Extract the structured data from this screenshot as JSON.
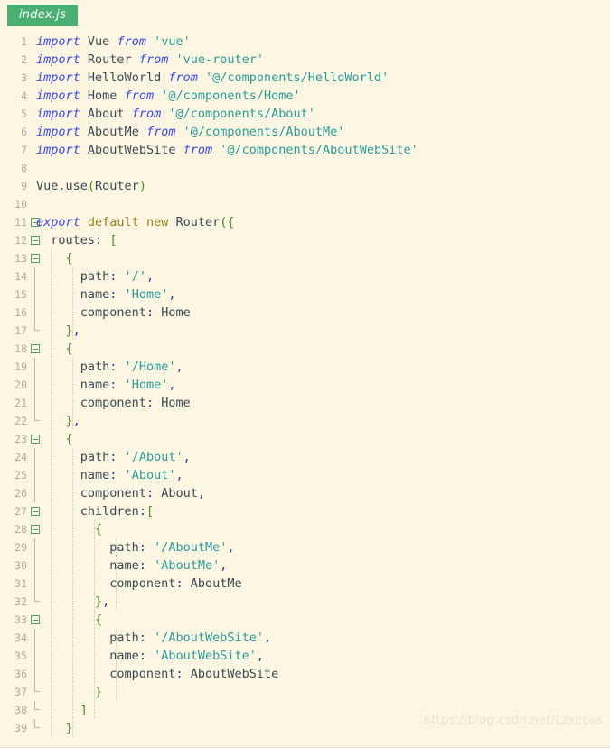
{
  "window": {
    "background_color": "#fdf6e3",
    "title": "index.js"
  },
  "tab": {
    "label": "index.js",
    "active": true,
    "background_color": "#4caf72",
    "text_color": "#ffffff"
  },
  "watermark": {
    "text": "https://blog.csdn.net/Lzxccas",
    "color": "#ece3cb"
  },
  "editor": {
    "language": "javascript",
    "first_line": 1,
    "last_line": 39,
    "line_count": 39,
    "theme_colors": {
      "background": "#fdf6e3",
      "keyword": "#3b4ae0",
      "keyword_secondary": "#93801f",
      "identifier": "#3b4a52",
      "string": "#2e9b97",
      "punctuation": "#4d8c2e",
      "colon": "#2a3f8f",
      "line_number": "#b3ab93",
      "fold_marker": "#5aa06e",
      "indent_guide": "#cfc8ae"
    },
    "lines": [
      {
        "n": 1,
        "fold": "none",
        "guides": 0,
        "tokens": [
          {
            "t": "import",
            "c": "kw"
          },
          {
            "t": " ",
            "c": "id"
          },
          {
            "t": "Vue",
            "c": "id"
          },
          {
            "t": " ",
            "c": "id"
          },
          {
            "t": "from",
            "c": "kw"
          },
          {
            "t": " ",
            "c": "id"
          },
          {
            "t": "'vue'",
            "c": "str"
          }
        ]
      },
      {
        "n": 2,
        "fold": "none",
        "guides": 0,
        "tokens": [
          {
            "t": "import",
            "c": "kw"
          },
          {
            "t": " ",
            "c": "id"
          },
          {
            "t": "Router",
            "c": "id"
          },
          {
            "t": " ",
            "c": "id"
          },
          {
            "t": "from",
            "c": "kw"
          },
          {
            "t": " ",
            "c": "id"
          },
          {
            "t": "'vue-router'",
            "c": "str"
          }
        ]
      },
      {
        "n": 3,
        "fold": "none",
        "guides": 0,
        "tokens": [
          {
            "t": "import",
            "c": "kw"
          },
          {
            "t": " ",
            "c": "id"
          },
          {
            "t": "HelloWorld",
            "c": "id"
          },
          {
            "t": " ",
            "c": "id"
          },
          {
            "t": "from",
            "c": "kw"
          },
          {
            "t": " ",
            "c": "id"
          },
          {
            "t": "'@/components/HelloWorld'",
            "c": "str"
          }
        ]
      },
      {
        "n": 4,
        "fold": "none",
        "guides": 0,
        "tokens": [
          {
            "t": "import",
            "c": "kw"
          },
          {
            "t": " ",
            "c": "id"
          },
          {
            "t": "Home",
            "c": "id"
          },
          {
            "t": " ",
            "c": "id"
          },
          {
            "t": "from",
            "c": "kw"
          },
          {
            "t": " ",
            "c": "id"
          },
          {
            "t": "'@/components/Home'",
            "c": "str"
          }
        ]
      },
      {
        "n": 5,
        "fold": "none",
        "guides": 0,
        "tokens": [
          {
            "t": "import",
            "c": "kw"
          },
          {
            "t": " ",
            "c": "id"
          },
          {
            "t": "About",
            "c": "id"
          },
          {
            "t": " ",
            "c": "id"
          },
          {
            "t": "from",
            "c": "kw"
          },
          {
            "t": " ",
            "c": "id"
          },
          {
            "t": "'@/components/About'",
            "c": "str"
          }
        ]
      },
      {
        "n": 6,
        "fold": "none",
        "guides": 0,
        "tokens": [
          {
            "t": "import",
            "c": "kw"
          },
          {
            "t": " ",
            "c": "id"
          },
          {
            "t": "AboutMe",
            "c": "id"
          },
          {
            "t": " ",
            "c": "id"
          },
          {
            "t": "from",
            "c": "kw"
          },
          {
            "t": " ",
            "c": "id"
          },
          {
            "t": "'@/components/AboutMe'",
            "c": "str"
          }
        ]
      },
      {
        "n": 7,
        "fold": "none",
        "guides": 0,
        "tokens": [
          {
            "t": "import",
            "c": "kw"
          },
          {
            "t": " ",
            "c": "id"
          },
          {
            "t": "AboutWebSite",
            "c": "id"
          },
          {
            "t": " ",
            "c": "id"
          },
          {
            "t": "from",
            "c": "kw"
          },
          {
            "t": " ",
            "c": "id"
          },
          {
            "t": "'@/components/AboutWebSite'",
            "c": "str"
          }
        ]
      },
      {
        "n": 8,
        "fold": "none",
        "guides": 0,
        "tokens": []
      },
      {
        "n": 9,
        "fold": "none",
        "guides": 0,
        "tokens": [
          {
            "t": "Vue.use",
            "c": "id"
          },
          {
            "t": "(",
            "c": "punc"
          },
          {
            "t": "Router",
            "c": "id"
          },
          {
            "t": ")",
            "c": "punc"
          }
        ]
      },
      {
        "n": 10,
        "fold": "none",
        "guides": 0,
        "tokens": []
      },
      {
        "n": 11,
        "fold": "start",
        "guides": 0,
        "tokens": [
          {
            "t": "export",
            "c": "kw"
          },
          {
            "t": " ",
            "c": "id"
          },
          {
            "t": "default",
            "c": "kw2"
          },
          {
            "t": " ",
            "c": "id"
          },
          {
            "t": "new",
            "c": "kw2"
          },
          {
            "t": " ",
            "c": "id"
          },
          {
            "t": "Router",
            "c": "id"
          },
          {
            "t": "({",
            "c": "punc"
          }
        ]
      },
      {
        "n": 12,
        "fold": "start",
        "guides": 0,
        "tokens": [
          {
            "t": "  ",
            "c": "id"
          },
          {
            "t": "routes",
            "c": "prop"
          },
          {
            "t": ":",
            "c": "colon"
          },
          {
            "t": " ",
            "c": "id"
          },
          {
            "t": "[",
            "c": "punc"
          }
        ]
      },
      {
        "n": 13,
        "fold": "start",
        "guides": 1,
        "tokens": [
          {
            "t": "    ",
            "c": "id"
          },
          {
            "t": "{",
            "c": "punc"
          }
        ]
      },
      {
        "n": 14,
        "fold": "line",
        "guides": 2,
        "tokens": [
          {
            "t": "      ",
            "c": "id"
          },
          {
            "t": "path",
            "c": "prop"
          },
          {
            "t": ":",
            "c": "colon"
          },
          {
            "t": " ",
            "c": "id"
          },
          {
            "t": "'/'",
            "c": "str"
          },
          {
            "t": ",",
            "c": "colon"
          }
        ]
      },
      {
        "n": 15,
        "fold": "line",
        "guides": 2,
        "tokens": [
          {
            "t": "      ",
            "c": "id"
          },
          {
            "t": "name",
            "c": "prop"
          },
          {
            "t": ":",
            "c": "colon"
          },
          {
            "t": " ",
            "c": "id"
          },
          {
            "t": "'Home'",
            "c": "str"
          },
          {
            "t": ",",
            "c": "colon"
          }
        ]
      },
      {
        "n": 16,
        "fold": "line",
        "guides": 2,
        "tokens": [
          {
            "t": "      ",
            "c": "id"
          },
          {
            "t": "component",
            "c": "prop"
          },
          {
            "t": ":",
            "c": "colon"
          },
          {
            "t": " ",
            "c": "id"
          },
          {
            "t": "Home",
            "c": "id"
          }
        ]
      },
      {
        "n": 17,
        "fold": "end",
        "guides": 2,
        "tokens": [
          {
            "t": "    ",
            "c": "id"
          },
          {
            "t": "}",
            "c": "punc"
          },
          {
            "t": ",",
            "c": "colon"
          }
        ]
      },
      {
        "n": 18,
        "fold": "start",
        "guides": 1,
        "tokens": [
          {
            "t": "    ",
            "c": "id"
          },
          {
            "t": "{",
            "c": "punc"
          }
        ]
      },
      {
        "n": 19,
        "fold": "line",
        "guides": 2,
        "tokens": [
          {
            "t": "      ",
            "c": "id"
          },
          {
            "t": "path",
            "c": "prop"
          },
          {
            "t": ":",
            "c": "colon"
          },
          {
            "t": " ",
            "c": "id"
          },
          {
            "t": "'/Home'",
            "c": "str"
          },
          {
            "t": ",",
            "c": "colon"
          }
        ]
      },
      {
        "n": 20,
        "fold": "line",
        "guides": 2,
        "tokens": [
          {
            "t": "      ",
            "c": "id"
          },
          {
            "t": "name",
            "c": "prop"
          },
          {
            "t": ":",
            "c": "colon"
          },
          {
            "t": " ",
            "c": "id"
          },
          {
            "t": "'Home'",
            "c": "str"
          },
          {
            "t": ",",
            "c": "colon"
          }
        ]
      },
      {
        "n": 21,
        "fold": "line",
        "guides": 2,
        "tokens": [
          {
            "t": "      ",
            "c": "id"
          },
          {
            "t": "component",
            "c": "prop"
          },
          {
            "t": ":",
            "c": "colon"
          },
          {
            "t": " ",
            "c": "id"
          },
          {
            "t": "Home",
            "c": "id"
          }
        ]
      },
      {
        "n": 22,
        "fold": "end",
        "guides": 2,
        "tokens": [
          {
            "t": "    ",
            "c": "id"
          },
          {
            "t": "}",
            "c": "punc"
          },
          {
            "t": ",",
            "c": "colon"
          }
        ]
      },
      {
        "n": 23,
        "fold": "start",
        "guides": 1,
        "tokens": [
          {
            "t": "    ",
            "c": "id"
          },
          {
            "t": "{",
            "c": "punc"
          }
        ]
      },
      {
        "n": 24,
        "fold": "line",
        "guides": 2,
        "tokens": [
          {
            "t": "      ",
            "c": "id"
          },
          {
            "t": "path",
            "c": "prop"
          },
          {
            "t": ":",
            "c": "colon"
          },
          {
            "t": " ",
            "c": "id"
          },
          {
            "t": "'/About'",
            "c": "str"
          },
          {
            "t": ",",
            "c": "colon"
          }
        ]
      },
      {
        "n": 25,
        "fold": "line",
        "guides": 2,
        "tokens": [
          {
            "t": "      ",
            "c": "id"
          },
          {
            "t": "name",
            "c": "prop"
          },
          {
            "t": ":",
            "c": "colon"
          },
          {
            "t": " ",
            "c": "id"
          },
          {
            "t": "'About'",
            "c": "str"
          },
          {
            "t": ",",
            "c": "colon"
          }
        ]
      },
      {
        "n": 26,
        "fold": "line",
        "guides": 2,
        "tokens": [
          {
            "t": "      ",
            "c": "id"
          },
          {
            "t": "component",
            "c": "prop"
          },
          {
            "t": ":",
            "c": "colon"
          },
          {
            "t": " ",
            "c": "id"
          },
          {
            "t": "About",
            "c": "id"
          },
          {
            "t": ",",
            "c": "colon"
          }
        ]
      },
      {
        "n": 27,
        "fold": "start",
        "guides": 2,
        "tokens": [
          {
            "t": "      ",
            "c": "id"
          },
          {
            "t": "children",
            "c": "prop"
          },
          {
            "t": ":",
            "c": "colon"
          },
          {
            "t": "[",
            "c": "punc"
          }
        ]
      },
      {
        "n": 28,
        "fold": "start",
        "guides": 3,
        "tokens": [
          {
            "t": "        ",
            "c": "id"
          },
          {
            "t": "{",
            "c": "punc"
          }
        ]
      },
      {
        "n": 29,
        "fold": "line",
        "guides": 4,
        "tokens": [
          {
            "t": "          ",
            "c": "id"
          },
          {
            "t": "path",
            "c": "prop"
          },
          {
            "t": ":",
            "c": "colon"
          },
          {
            "t": " ",
            "c": "id"
          },
          {
            "t": "'/AboutMe'",
            "c": "str"
          },
          {
            "t": ",",
            "c": "colon"
          }
        ]
      },
      {
        "n": 30,
        "fold": "line",
        "guides": 4,
        "tokens": [
          {
            "t": "          ",
            "c": "id"
          },
          {
            "t": "name",
            "c": "prop"
          },
          {
            "t": ":",
            "c": "colon"
          },
          {
            "t": " ",
            "c": "id"
          },
          {
            "t": "'AboutMe'",
            "c": "str"
          },
          {
            "t": ",",
            "c": "colon"
          }
        ]
      },
      {
        "n": 31,
        "fold": "line",
        "guides": 4,
        "tokens": [
          {
            "t": "          ",
            "c": "id"
          },
          {
            "t": "component",
            "c": "prop"
          },
          {
            "t": ":",
            "c": "colon"
          },
          {
            "t": " ",
            "c": "id"
          },
          {
            "t": "AboutMe",
            "c": "id"
          }
        ]
      },
      {
        "n": 32,
        "fold": "end",
        "guides": 4,
        "tokens": [
          {
            "t": "        ",
            "c": "id"
          },
          {
            "t": "}",
            "c": "punc"
          },
          {
            "t": ",",
            "c": "colon"
          }
        ]
      },
      {
        "n": 33,
        "fold": "start",
        "guides": 3,
        "tokens": [
          {
            "t": "        ",
            "c": "id"
          },
          {
            "t": "{",
            "c": "punc"
          }
        ]
      },
      {
        "n": 34,
        "fold": "line",
        "guides": 4,
        "tokens": [
          {
            "t": "          ",
            "c": "id"
          },
          {
            "t": "path",
            "c": "prop"
          },
          {
            "t": ":",
            "c": "colon"
          },
          {
            "t": " ",
            "c": "id"
          },
          {
            "t": "'/AboutWebSite'",
            "c": "str"
          },
          {
            "t": ",",
            "c": "colon"
          }
        ]
      },
      {
        "n": 35,
        "fold": "line",
        "guides": 4,
        "tokens": [
          {
            "t": "          ",
            "c": "id"
          },
          {
            "t": "name",
            "c": "prop"
          },
          {
            "t": ":",
            "c": "colon"
          },
          {
            "t": " ",
            "c": "id"
          },
          {
            "t": "'AboutWebSite'",
            "c": "str"
          },
          {
            "t": ",",
            "c": "colon"
          }
        ]
      },
      {
        "n": 36,
        "fold": "line",
        "guides": 4,
        "tokens": [
          {
            "t": "          ",
            "c": "id"
          },
          {
            "t": "component",
            "c": "prop"
          },
          {
            "t": ":",
            "c": "colon"
          },
          {
            "t": " ",
            "c": "id"
          },
          {
            "t": "AboutWebSite",
            "c": "id"
          }
        ]
      },
      {
        "n": 37,
        "fold": "end",
        "guides": 4,
        "tokens": [
          {
            "t": "        ",
            "c": "id"
          },
          {
            "t": "}",
            "c": "punc"
          }
        ]
      },
      {
        "n": 38,
        "fold": "end",
        "guides": 3,
        "tokens": [
          {
            "t": "      ",
            "c": "id"
          },
          {
            "t": "]",
            "c": "punc"
          }
        ]
      },
      {
        "n": 39,
        "fold": "end",
        "guides": 2,
        "tokens": [
          {
            "t": "    ",
            "c": "id"
          },
          {
            "t": "}",
            "c": "punc"
          }
        ]
      }
    ]
  }
}
